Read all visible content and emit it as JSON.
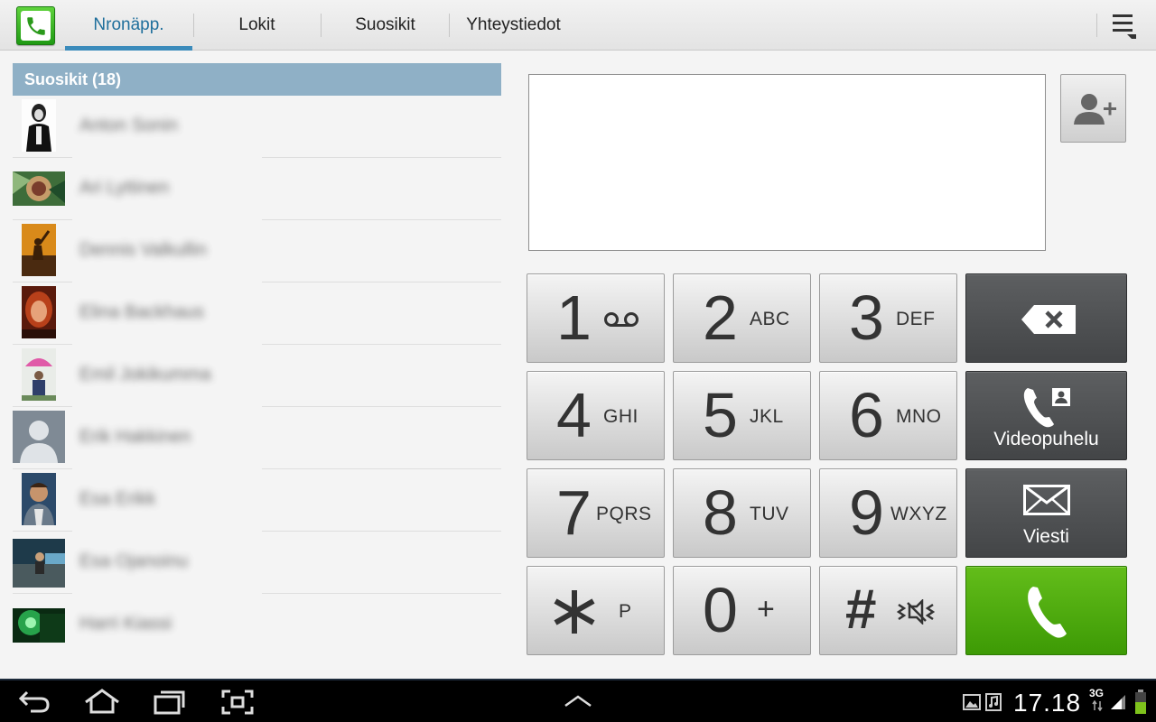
{
  "tabs": [
    {
      "label": "Nronäpp.",
      "active": true
    },
    {
      "label": "Lokit",
      "active": false
    },
    {
      "label": "Suosikit",
      "active": false
    },
    {
      "label": "Yhteystiedot",
      "active": false
    }
  ],
  "favorites": {
    "header": "Suosikit (18)",
    "contacts": [
      {
        "name": "Anton Sonin",
        "avatar": "portrait-dark"
      },
      {
        "name": "Ari Lyttinen",
        "avatar": "green-artwork"
      },
      {
        "name": "Dennis Valkullin",
        "avatar": "concert-photo"
      },
      {
        "name": "Elina Backhaus",
        "avatar": "redhead-photo"
      },
      {
        "name": "Emil Jokikumma",
        "avatar": "umbrella-photo"
      },
      {
        "name": "Erik Hakkinen",
        "avatar": "default-silhouette"
      },
      {
        "name": "Esa Erikk",
        "avatar": "man-portrait"
      },
      {
        "name": "Esa Ojanoinu",
        "avatar": "outdoor-photo"
      },
      {
        "name": "Harri Kiassi",
        "avatar": "green-light"
      }
    ]
  },
  "dialer": {
    "number": "",
    "keys": [
      {
        "digit": "1",
        "letters": "",
        "icon": "voicemail-icon"
      },
      {
        "digit": "2",
        "letters": "ABC"
      },
      {
        "digit": "3",
        "letters": "DEF"
      },
      {
        "digit": "4",
        "letters": "GHI"
      },
      {
        "digit": "5",
        "letters": "JKL"
      },
      {
        "digit": "6",
        "letters": "MNO"
      },
      {
        "digit": "7",
        "letters": "PQRS"
      },
      {
        "digit": "8",
        "letters": "TUV"
      },
      {
        "digit": "9",
        "letters": "WXYZ"
      },
      {
        "digit": "*",
        "letters": "P"
      },
      {
        "digit": "0",
        "letters": "+"
      },
      {
        "digit": "#",
        "letters": "",
        "icon": "mute-icon"
      }
    ],
    "video_call_label": "Videopuhelu",
    "message_label": "Viesti"
  },
  "status_bar": {
    "time": "17.18",
    "network": "3G"
  },
  "colors": {
    "accent": "#3b8bbb",
    "call_green": "#4caf0e",
    "favorites_header": "#8fb0c6",
    "dark_key": "#4e5052"
  }
}
